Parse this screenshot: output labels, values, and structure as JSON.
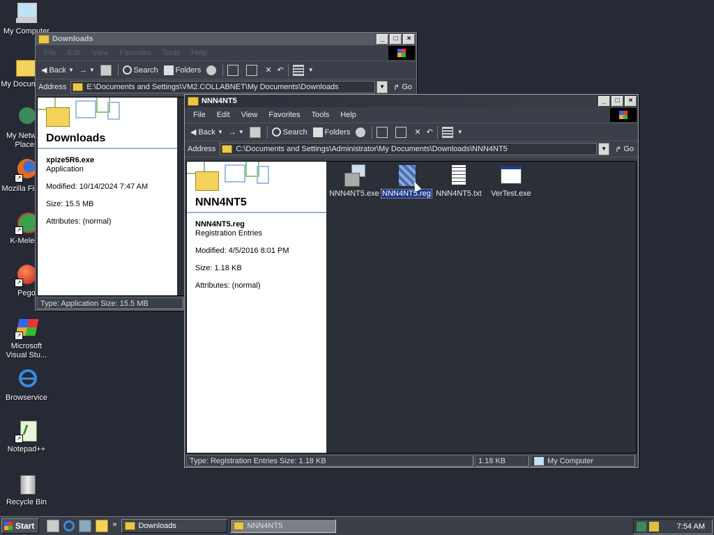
{
  "desktop": {
    "icons": [
      {
        "label": "My Computer"
      },
      {
        "label": "My Documents"
      },
      {
        "label": "My Network Places"
      },
      {
        "label": "Mozilla Firefox"
      },
      {
        "label": "K-Meleon"
      },
      {
        "label": "Pego"
      },
      {
        "label": "Microsoft Visual Stu..."
      },
      {
        "label": "Browservice"
      },
      {
        "label": "Notepad++"
      },
      {
        "label": "Recycle Bin"
      }
    ]
  },
  "back_window": {
    "title": "Downloads",
    "menu": [
      "File",
      "Edit",
      "View",
      "Favorites",
      "Tools",
      "Help"
    ],
    "toolbar": {
      "back": "Back",
      "search": "Search",
      "folders": "Folders"
    },
    "address_label": "Address",
    "address_value": "E:\\Documents and Settings\\VM2.COLLABNET\\My Documents\\Downloads",
    "go_label": "Go",
    "pane_title": "Downloads",
    "details": {
      "name": "xpize5R6.exe",
      "type": "Application",
      "modified": "Modified: 10/14/2024 7:47 AM",
      "size": "Size: 15.5 MB",
      "attributes": "Attributes: (normal)"
    },
    "status": "Type: Application Size: 15.5 MB"
  },
  "front_window": {
    "title": "NNN4NT5",
    "menu": [
      "File",
      "Edit",
      "View",
      "Favorites",
      "Tools",
      "Help"
    ],
    "toolbar": {
      "back": "Back",
      "search": "Search",
      "folders": "Folders"
    },
    "address_label": "Address",
    "address_value": "C:\\Documents and Settings\\Administrator\\My Documents\\Downloads\\NNN4NT5",
    "go_label": "Go",
    "pane_title": "NNN4NT5",
    "details": {
      "name": "NNN4NT5.reg",
      "type": "Registration Entries",
      "modified": "Modified: 4/5/2016 8:01 PM",
      "size": "Size: 1.18 KB",
      "attributes": "Attributes: (normal)"
    },
    "files": [
      {
        "name": "NNN4NT5.exe",
        "icon": "setup-exe-icon"
      },
      {
        "name": "NNN4NT5.reg",
        "icon": "registry-file-icon"
      },
      {
        "name": "NNN4NT5.txt",
        "icon": "text-file-icon"
      },
      {
        "name": "VerTest.exe",
        "icon": "application-window-icon"
      }
    ],
    "status": {
      "main": "Type: Registration Entries Size: 1.18 KB",
      "size": "1.18 KB",
      "zone": "My Computer"
    }
  },
  "taskbar": {
    "start_label": "Start",
    "tasks": [
      {
        "label": "Downloads"
      },
      {
        "label": "NNN4NT5"
      }
    ],
    "clock": "7:54 AM"
  }
}
